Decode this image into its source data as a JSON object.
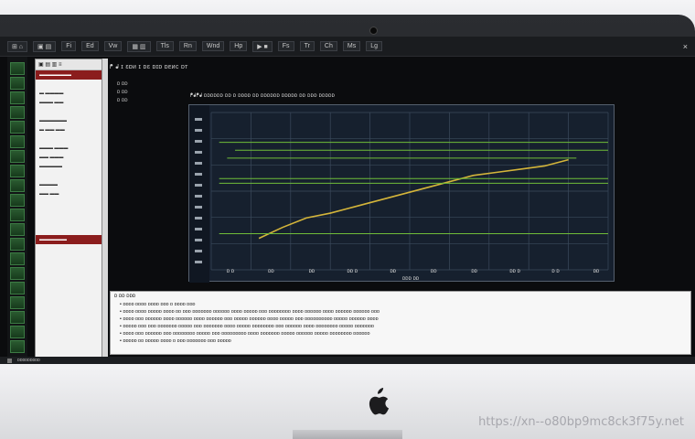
{
  "toolbar": {
    "items": [
      "⊞ ⌂",
      "▣ ▤",
      "Fi",
      "Ed",
      "Vw",
      "▦ ▥",
      "Tls",
      "Rn",
      "Wnd",
      "Hp",
      "▶ ■",
      "Fs",
      "Tr",
      "Ch",
      "Ms",
      "Lg"
    ],
    "close_label": "×"
  },
  "file_panel": {
    "title": "▣ ▤ ▥ ≡",
    "rows": [
      {
        "label": "▬▬▬▬▬▬▬",
        "selected": true
      },
      {
        "label": "",
        "selected": false
      },
      {
        "label": "▬ ▬▬▬▬",
        "selected": false
      },
      {
        "label": "▬▬▬ ▬▬",
        "selected": false
      },
      {
        "label": "",
        "selected": false
      },
      {
        "label": "▬▬▬▬▬▬",
        "selected": false
      },
      {
        "label": "▬ ▬▬ ▬▬",
        "selected": false
      },
      {
        "label": "",
        "selected": false
      },
      {
        "label": "▬▬▬ ▬▬▬",
        "selected": false
      },
      {
        "label": "▬▬ ▬▬▬",
        "selected": false
      },
      {
        "label": "▬▬▬▬▬",
        "selected": false
      },
      {
        "label": "",
        "selected": false
      },
      {
        "label": "▬▬▬▬",
        "selected": false
      },
      {
        "label": "▬▬ ▬▬",
        "selected": false
      },
      {
        "label": "",
        "selected": false
      },
      {
        "label": "",
        "selected": false
      },
      {
        "label": "",
        "selected": false
      },
      {
        "label": "",
        "selected": false
      },
      {
        "label": "▬▬▬▬▬▬",
        "selected": true
      }
    ]
  },
  "main": {
    "header": "ᖰ ᖱ ɪ ɛɒᴎ ɪ ᴅɛ ᴅɪᴅ ᴅᴇᴎᴄ ᴅᴛ",
    "side_notes": [
      "ᴅ ᴅᴅ",
      "ᴅ ᴅᴅ",
      "ᴅ ᴅᴅ"
    ],
    "plot_caption": "ᖰᖱᖰᖱ ᴅᴅᴅᴅᴅᴅ ᴅᴅ ᴅ ᴅᴅᴅᴅ ᴅᴅ ᴅᴅᴅᴅᴅᴅ ᴅᴅᴅᴅᴅ ᴅᴅ ᴅᴅᴅ ᴅᴅᴅᴅᴅ",
    "x_ticks": [
      "ᴅ ᴅ",
      "ᴅᴅ",
      "ᴅᴅ",
      "ᴅᴅ ᴅ",
      "ᴅᴅ",
      "ᴅᴅ",
      "ᴅᴅ",
      "ᴅᴅ ᴅ",
      "ᴅ ᴅ",
      "ᴅᴅ"
    ],
    "x_label": "ᴅᴅᴅ ᴅᴅ"
  },
  "chart_data": {
    "type": "line",
    "title": "",
    "xlabel": "",
    "ylabel": "",
    "grid": true,
    "background": "#16202e",
    "xlim": [
      0,
      100
    ],
    "ylim": [
      0,
      100
    ],
    "series": [
      {
        "color": "#d4b53a",
        "x": [
          12,
          18,
          24,
          30,
          36,
          42,
          48,
          54,
          60,
          66,
          72,
          78,
          84,
          90
        ],
        "y": [
          20,
          27,
          33,
          36,
          40,
          44,
          48,
          52,
          56,
          60,
          62,
          64,
          66,
          70
        ]
      },
      {
        "color": "#6fbd39",
        "x": [
          2,
          100
        ],
        "y": [
          81,
          81
        ]
      },
      {
        "color": "#6fbd39",
        "x": [
          6,
          100
        ],
        "y": [
          76,
          76
        ]
      },
      {
        "color": "#6fbd39",
        "x": [
          4,
          92
        ],
        "y": [
          71,
          71
        ]
      },
      {
        "color": "#6fbd39",
        "x": [
          2,
          100
        ],
        "y": [
          58,
          58
        ]
      },
      {
        "color": "#6fbd39",
        "x": [
          2,
          100
        ],
        "y": [
          55,
          55
        ]
      },
      {
        "color": "#6fbd39",
        "x": [
          2,
          100
        ],
        "y": [
          23,
          23
        ]
      }
    ]
  },
  "log": {
    "header": "ᴅ ᴅᴅ ᴅᴅᴅ",
    "lines": [
      "ᴅᴅᴅᴅ ᴅᴅᴅᴅ ᴅᴅᴅᴅ ᴅᴅᴅ ᴅ ᴅᴅᴅᴅ ᴅᴅᴅ",
      "ᴅᴅᴅᴅ ᴅᴅᴅᴅ ᴅᴅᴅᴅᴅ ᴅᴅᴅᴅ ᴅᴅ ᴅᴅᴅ ᴅᴅᴅᴅᴅᴅᴅ ᴅᴅᴅᴅᴅᴅ ᴅᴅᴅᴅ ᴅᴅᴅᴅᴅ ᴅᴅᴅ ᴅᴅᴅᴅᴅᴅᴅᴅ ᴅᴅᴅᴅ ᴅᴅᴅᴅᴅᴅ ᴅᴅᴅᴅ ᴅᴅᴅᴅᴅᴅ ᴅᴅᴅᴅᴅᴅ ᴅᴅᴅ",
      "ᴅᴅᴅᴅ ᴅᴅᴅ ᴅᴅᴅᴅᴅᴅ ᴅᴅᴅᴅ ᴅᴅᴅᴅᴅᴅ ᴅᴅᴅᴅ ᴅᴅᴅᴅᴅᴅ ᴅᴅᴅ ᴅᴅᴅᴅᴅ ᴅᴅᴅᴅᴅᴅ ᴅᴅᴅᴅ ᴅᴅᴅᴅᴅ ᴅᴅᴅ ᴅᴅᴅᴅᴅᴅᴅᴅᴅᴅ ᴅᴅᴅᴅᴅ ᴅᴅᴅᴅᴅᴅ ᴅᴅᴅᴅ",
      "ᴅᴅᴅᴅᴅ ᴅᴅᴅ ᴅᴅᴅ ᴅᴅᴅᴅᴅᴅᴅ ᴅᴅᴅᴅᴅ ᴅᴅᴅ ᴅᴅᴅᴅᴅᴅᴅ ᴅᴅᴅᴅ ᴅᴅᴅᴅᴅ ᴅᴅᴅᴅᴅᴅᴅᴅ ᴅᴅᴅ ᴅᴅᴅᴅᴅᴅ ᴅᴅᴅᴅ ᴅᴅᴅᴅᴅᴅᴅᴅ ᴅᴅᴅᴅᴅ ᴅᴅᴅᴅᴅᴅᴅ",
      "ᴅᴅᴅᴅ ᴅᴅᴅ ᴅᴅᴅᴅᴅᴅ ᴅᴅᴅ ᴅᴅᴅᴅᴅᴅᴅᴅ ᴅᴅᴅᴅᴅ ᴅᴅᴅ ᴅᴅᴅᴅᴅᴅᴅᴅᴅ ᴅᴅᴅᴅ ᴅᴅᴅᴅᴅᴅᴅ ᴅᴅᴅᴅᴅ ᴅᴅᴅᴅᴅᴅ ᴅᴅᴅᴅᴅ ᴅᴅᴅᴅᴅᴅᴅᴅ ᴅᴅᴅᴅᴅᴅ",
      "ᴅᴅᴅᴅᴅ ᴅᴅ ᴅᴅᴅᴅᴅ ᴅᴅᴅᴅ ᴅ ᴅᴅᴅ ᴅᴅᴅᴅᴅᴅᴅ ᴅᴅᴅ ᴅᴅᴅᴅᴅ"
    ]
  },
  "statusbar": {
    "text": "ᴅᴅᴅᴅᴅᴅᴅᴅᴅ"
  },
  "watermark": "https://xn--o80bp9mc8ck3f75y.net",
  "colors": {
    "bezel": "#1a1b1d",
    "chart_bg": "#16202e",
    "grid": "#3b4a5c",
    "gold_series": "#d4b53a",
    "green_series": "#6fbd39",
    "selected_row": "#8b1d1d"
  }
}
